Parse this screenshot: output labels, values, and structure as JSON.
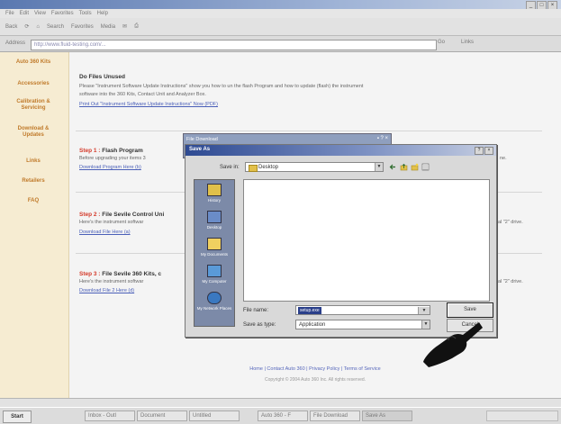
{
  "browser": {
    "window_title": "",
    "menu": [
      "File",
      "Edit",
      "View",
      "Favorites",
      "Tools",
      "Help"
    ],
    "toolbar": [
      "Back",
      "Search",
      "Favorites",
      "Media"
    ],
    "address_label": "Address",
    "address_value": "http://www.fluid-testing.com/...",
    "go_label": "Go",
    "links_label": "Links"
  },
  "sidebar": {
    "items": [
      {
        "label": "Auto 360 Kits"
      },
      {
        "label": "Accessories"
      },
      {
        "label": "Calibration & Servicing"
      },
      {
        "label": "Download & Updates"
      },
      {
        "label": "Links"
      },
      {
        "label": "Retailers"
      },
      {
        "label": "FAQ"
      }
    ]
  },
  "content": {
    "intro_heading": "Do Files Unused",
    "intro_lines": [
      "Please \"Instrument Software Update Instructions\" show you how to un the flash Program and how to update (flash) the instrument",
      "software into the 360 Kits, Contact Unit and Analyzer Box."
    ],
    "intro_link": "Print Out \"Instrument Software Update Instructions\" Now (PDF)",
    "steps": [
      {
        "num": "Step 1 :",
        "title": "Flash Program",
        "desc": "Before upgrading your items 3",
        "desc_right": "ne.",
        "link": "Download Program Here (b)"
      },
      {
        "num": "Step 2 :",
        "title": "File Sevile Control Uni",
        "desc": "Here's the instrument softwar",
        "desc_right": "al \"2\" drive.",
        "link": "Download File Here (a)"
      },
      {
        "num": "Step 3 :",
        "title": "File Sevile 360 Kits, c",
        "desc": "Here's the instrument softwar",
        "desc_right": "al \"2\" drive.",
        "link": "Download File 2 Here (d)"
      }
    ],
    "footer_links": "Home | Contact Auto 360 | Privacy Policy | Terms of Service",
    "copyright": "Copyright © 2004 Auto 360 Inc. All rights reserved."
  },
  "back_dialog": {
    "title": "File Download"
  },
  "save_dialog": {
    "title": "Save As",
    "save_in_label": "Save in:",
    "save_in_value": "Desktop",
    "places": [
      {
        "label": "History",
        "icon": "history-icon"
      },
      {
        "label": "Desktop",
        "icon": "desktop-icon"
      },
      {
        "label": "My Documents",
        "icon": "my-documents-icon"
      },
      {
        "label": "My Computer",
        "icon": "my-computer-icon"
      },
      {
        "label": "My Network Places",
        "icon": "network-places-icon"
      }
    ],
    "file_name_label": "File name:",
    "file_name_value": "setup.exe",
    "file_type_label": "Save as type:",
    "file_type_value": "Application",
    "save_label": "Save",
    "cancel_label": "Cancel"
  },
  "taskbar": {
    "start_label": "Start",
    "tasks": [
      "Inbox - Outl",
      "Document",
      "Untitled",
      "Auto 360 - F",
      "File Download",
      "Save As"
    ],
    "tray_time": ""
  },
  "colors": {
    "accent": "#c07a2a",
    "step": "#d43a2a",
    "link": "#4a5fb8",
    "dialog_title": "#2e4a92"
  }
}
